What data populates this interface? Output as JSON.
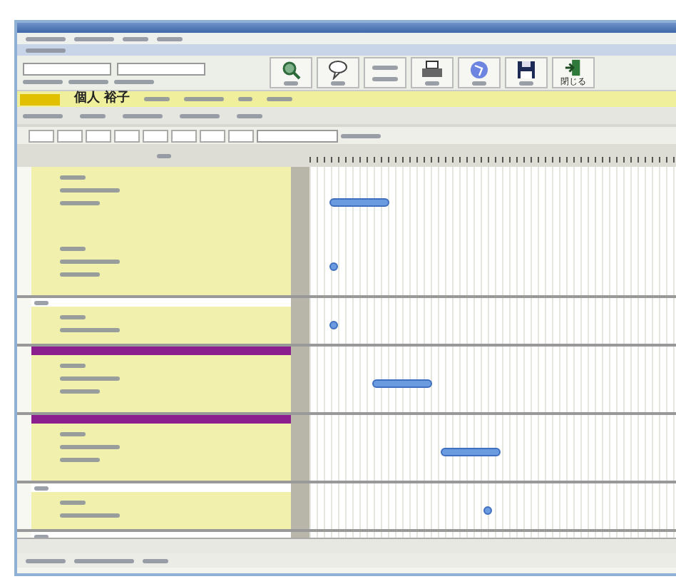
{
  "patient": {
    "name": "個人 裕子"
  },
  "toolbar": {
    "buttons": [
      {
        "kind": "view"
      },
      {
        "kind": "comment"
      },
      {
        "kind": "textpair"
      },
      {
        "kind": "print"
      },
      {
        "kind": "globe"
      },
      {
        "kind": "save"
      },
      {
        "kind": "exit",
        "label": "閉じる"
      }
    ]
  },
  "schedule": {
    "rows": [
      {
        "kind": "plain",
        "entries": [
          {
            "kind": "bar"
          },
          {
            "kind": "dot"
          }
        ]
      },
      {
        "kind": "labelled",
        "entries": [
          {
            "kind": "dot"
          }
        ]
      },
      {
        "kind": "banded",
        "entries": [
          {
            "kind": "bar"
          }
        ]
      },
      {
        "kind": "banded",
        "entries": [
          {
            "kind": "bar"
          }
        ]
      },
      {
        "kind": "labelled",
        "entries": [
          {
            "kind": "dot"
          }
        ]
      },
      {
        "kind": "labelled"
      }
    ]
  }
}
